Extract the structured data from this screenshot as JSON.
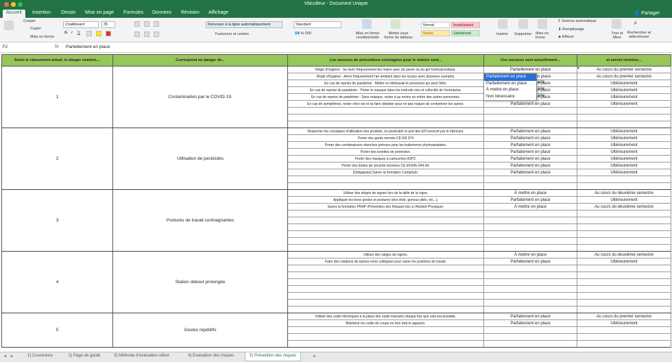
{
  "window": {
    "title": "Viticulteur - Document Unique"
  },
  "ribbon_tabs": [
    "Accueil",
    "Insertion",
    "Dessin",
    "Mise en page",
    "Formules",
    "Données",
    "Révision",
    "Affichage"
  ],
  "share_label": "Partager",
  "ribbon": {
    "cut": "Couper",
    "copy": "Copier",
    "paste_format": "Mise en forme",
    "font_name": "Chalkboard",
    "font_size": "35",
    "wrap": "Renvoyer à la ligne automatiquement",
    "merge": "Fusionner et centrer",
    "number_format": "Standard",
    "cond_format": "Mise en forme conditionnelle",
    "table_format": "Mettre sous forme de tableau",
    "styles": [
      {
        "label": "Normal",
        "bg": "#ffffff",
        "fg": "#222222"
      },
      {
        "label": "Insatisfaisant",
        "bg": "#ffc7ce",
        "fg": "#9c0006"
      },
      {
        "label": "Neutre",
        "bg": "#ffeb9c",
        "fg": "#9c5700"
      },
      {
        "label": "Satisfaisant",
        "bg": "#c6efce",
        "fg": "#006100"
      }
    ],
    "insert": "Insérer",
    "delete": "Supprimer",
    "format": "Mise en forme",
    "autosum": "Somme automatique",
    "fill": "Remplissage",
    "clear": "Effacer",
    "sort": "Trier et filtrer",
    "find": "Rechercher et sélectionner"
  },
  "formula_bar": {
    "cell": "F2",
    "fx": "fx",
    "value": "Partiellement en place"
  },
  "headers": [
    "Selon le classement actuel, le danger numéro....",
    "Correspond au danger de...",
    "Les mesures de préventions envisagées pour le réduire sont...",
    "Ces mesures sont actuellement...",
    "et seront révisées..."
  ],
  "groups": [
    {
      "num": "1",
      "danger": "Contamination par le COVID-19.",
      "rows": [
        {
          "m": "Règle d'hygiène : Se laver fréquemment les mains avec du savon ou du gel hydroalcoolique.",
          "s": "Partiellement en place",
          "r": "Au cours du premier semestre"
        },
        {
          "m": "Règle d'hygiène : Aérer fréquemment l'air ambiant dans les locaux avec plusieurs ouvrants.",
          "s": "Partiellement en place",
          "r": "Au cours du premier semestre"
        },
        {
          "m": "En cas de reprise de pandémie : Mettre en télétravail le personnel qui peut l'être.",
          "s": "Parfaitement en place",
          "r": "Ultérieurement"
        },
        {
          "m": "En cas de reprise de pandémie : Porter le masque dans les endroits clos et collectifs de l'entreprise.",
          "s": "Parfaitement en place",
          "r": "Ultérieurement"
        },
        {
          "m": "En cas de reprise de pandémie : Sans masque, rester à au moins un mètre des autres personnes.",
          "s": "Parfaitement en place",
          "r": "Ultérieurement"
        },
        {
          "m": "En cas de symptômes, rester chez soi et se faire dépister pour ne pas risquer de contaminer les autres.",
          "s": "Parfaitement en place",
          "r": "Ultérieurement"
        },
        {
          "m": "",
          "s": "",
          "r": ""
        },
        {
          "m": "",
          "s": "",
          "r": ""
        },
        {
          "m": "",
          "s": "",
          "r": ""
        }
      ]
    },
    {
      "num": "2",
      "danger": "Utilisation de pesticides",
      "rows": [
        {
          "m": "Respecter les consignes d'utilisation des produits, en particulier le port des EPI prescrit par le fabricant.",
          "s": "Parfaitement en place",
          "r": "Ultérieurement"
        },
        {
          "m": "Porter des gants normés CE EN 374",
          "s": "Parfaitement en place",
          "r": "Ultérieurement"
        },
        {
          "m": "Porter des combinaisons étanches prévues pour les traitements phytosanitaires.",
          "s": "Parfaitement en place",
          "r": "Ultérieurement"
        },
        {
          "m": "Porter des lunettes de protection.",
          "s": "Parfaitement en place",
          "r": "Ultérieurement"
        },
        {
          "m": "Porter des masques à cartouches A2P2.",
          "s": "Parfaitement en place",
          "r": "Ultérieurement"
        },
        {
          "m": "Porter des bottes de sécurité normées CE EN345-344-34.",
          "s": "Parfaitement en place",
          "r": "Ultérieurement"
        },
        {
          "m": "[Obligatoire] Suivre la formation Certiphyto.",
          "s": "Parfaitement en place",
          "r": "Ultérieurement"
        },
        {
          "m": "",
          "s": "",
          "r": ""
        },
        {
          "m": "",
          "s": "",
          "r": ""
        }
      ]
    },
    {
      "num": "3",
      "danger": "Postures de travail contraignantes",
      "rows": [
        {
          "m": "Utiliser des sièges de vignes lors de la taille de la vigne.",
          "s": "À mettre en place",
          "r": "Au cours du deuxième semestre"
        },
        {
          "m": "Appliquer les bons gestes et postures (dos droit, genoux pliés, etc...).",
          "s": "Parfaitement en place",
          "r": "Ultérieurement"
        },
        {
          "m": "Suivre la formation PRAP (Prévention des Risques liés à l'Activité Physique).",
          "s": "À mettre en place",
          "r": "Au cours du deuxième semestre"
        },
        {
          "m": "",
          "s": "",
          "r": ""
        },
        {
          "m": "",
          "s": "",
          "r": ""
        },
        {
          "m": "",
          "s": "",
          "r": ""
        },
        {
          "m": "",
          "s": "",
          "r": ""
        },
        {
          "m": "",
          "s": "",
          "r": ""
        },
        {
          "m": "",
          "s": "",
          "r": ""
        }
      ]
    },
    {
      "num": "4",
      "danger": "Station debout prolongée",
      "rows": [
        {
          "m": "Utiliser des sièges de vignes.",
          "s": "À mettre en place",
          "r": "Au cours du deuxième semestre"
        },
        {
          "m": "Faire des rotations de taches entre collègues pour varier les positions de travail.",
          "s": "Parfaitement en place",
          "r": "Ultérieurement"
        },
        {
          "m": "",
          "s": "",
          "r": ""
        },
        {
          "m": "",
          "s": "",
          "r": ""
        },
        {
          "m": "",
          "s": "",
          "r": ""
        },
        {
          "m": "",
          "s": "",
          "r": ""
        },
        {
          "m": "",
          "s": "",
          "r": ""
        },
        {
          "m": "",
          "s": "",
          "r": ""
        },
        {
          "m": "",
          "s": "",
          "r": ""
        }
      ]
    },
    {
      "num": "5",
      "danger": "Gestes répétitifs",
      "rows": [
        {
          "m": "Utiliser des outils électriques à la place des outils manuels chaque fois que cela est possible.",
          "s": "Parfaitement en place",
          "r": "Au cours du premier semestre"
        },
        {
          "m": "Maintenir les outils de coupe en bon état et aiguisés.",
          "s": "Parfaitement en place",
          "r": "Ultérieurement"
        },
        {
          "m": "",
          "s": "",
          "r": ""
        },
        {
          "m": "",
          "s": "",
          "r": ""
        },
        {
          "m": "",
          "s": "",
          "r": ""
        }
      ]
    }
  ],
  "dropdown": {
    "options": [
      "Parfaitement en place",
      "Partiellement en place",
      "À mettre en place",
      "Non nécessaire"
    ],
    "selected": 0
  },
  "dropdown_tails": [
    "aire",
    "aire",
    "aire"
  ],
  "sheet_tabs": [
    "1) Couverture",
    "2) Page de garde",
    "3) Méthode d'évaluation utilisé",
    "4) Evaluation des risques",
    "5) Prévention des risques"
  ],
  "sheet_active": 4,
  "add_sheet": "+",
  "colors": {
    "accent": "#217346",
    "header_fill": "#97c65a",
    "select": "#2a6fd6"
  }
}
